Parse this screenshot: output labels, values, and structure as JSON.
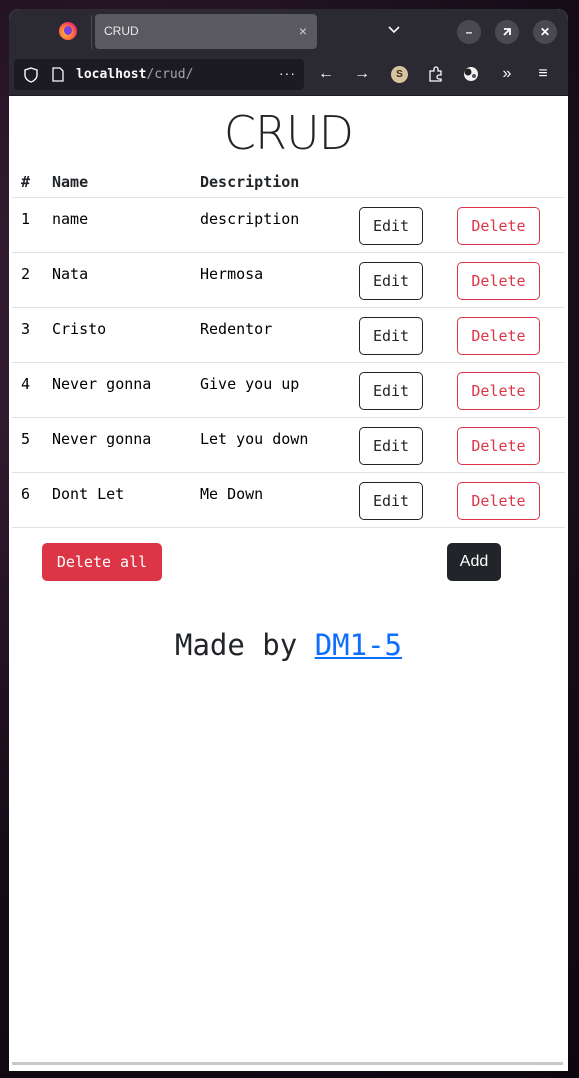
{
  "browser": {
    "tab_title": "CRUD",
    "tab_close": "×",
    "url_host": "localhost",
    "url_path": "/crud/",
    "url_more": "···",
    "profile_initial": "S",
    "colors": {
      "chrome": "#2b2a33",
      "urlbar": "#1c1b22"
    }
  },
  "page": {
    "title": "CRUD",
    "columns": [
      "#",
      "Name",
      "Description"
    ],
    "rows": [
      {
        "id": "1",
        "name": "name",
        "description": "description"
      },
      {
        "id": "2",
        "name": "Nata",
        "description": "Hermosa"
      },
      {
        "id": "3",
        "name": "Cristo",
        "description": "Redentor"
      },
      {
        "id": "4",
        "name": "Never gonna",
        "description": "Give you up"
      },
      {
        "id": "5",
        "name": "Never gonna",
        "description": "Let you down"
      },
      {
        "id": "6",
        "name": "Dont Let",
        "description": "Me Down"
      }
    ],
    "edit_label": "Edit",
    "delete_label": "Delete",
    "delete_all_label": "Delete all",
    "add_label": "Add",
    "footer_prefix": "Made by ",
    "footer_link": "DM1-5",
    "colors": {
      "danger": "#dc3545",
      "dark": "#212529",
      "link": "#0d6efd"
    }
  }
}
